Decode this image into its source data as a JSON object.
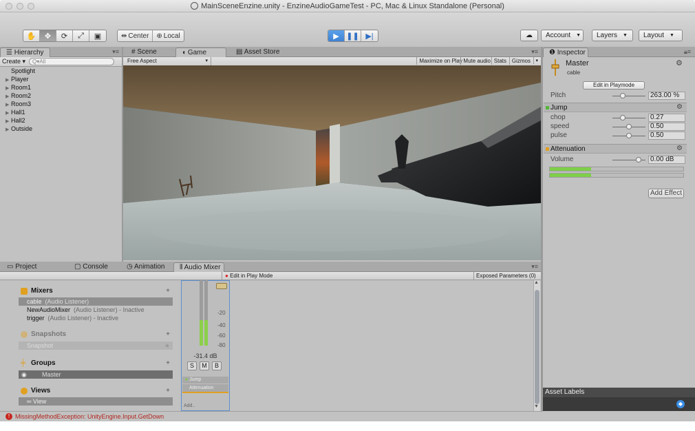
{
  "window": {
    "title": "MainSceneEnzine.unity - EnzineAudioGameTest - PC, Mac & Linux Standalone (Personal)"
  },
  "toolbar": {
    "tools": [
      "hand-icon",
      "move-icon",
      "rotate-icon",
      "scale-icon",
      "rect-icon"
    ],
    "pivot_label": "Center",
    "space_label": "Local",
    "play_icons": [
      "play-icon",
      "pause-icon",
      "step-icon"
    ],
    "account_label": "Account",
    "layers_label": "Layers",
    "layout_label": "Layout"
  },
  "hierarchy": {
    "tab_label": "Hierarchy",
    "create_label": "Create",
    "search_placeholder": "Q▾All",
    "items": [
      {
        "label": "Spotlight",
        "arrow": ""
      },
      {
        "label": "Player",
        "arrow": "▶"
      },
      {
        "label": "Room1",
        "arrow": "▶"
      },
      {
        "label": "Room2",
        "arrow": "▶"
      },
      {
        "label": "Room3",
        "arrow": "▶"
      },
      {
        "label": "Hall1",
        "arrow": "▶"
      },
      {
        "label": "Hall2",
        "arrow": "▶"
      },
      {
        "label": "Outside",
        "arrow": "▶"
      }
    ]
  },
  "center_tabs": {
    "scene": "Scene",
    "game": "Game",
    "asset_store": "Asset Store"
  },
  "game_bar": {
    "aspect": "Free Aspect",
    "maximize": "Maximize on Play",
    "mute": "Mute audio",
    "stats": "Stats",
    "gizmos": "Gizmos"
  },
  "inspector": {
    "tab_label": "Inspector",
    "object_name": "Master",
    "object_sub": "cable",
    "edit_button": "Edit in Playmode",
    "pitch_label": "Pitch",
    "pitch_value": "263.00 %",
    "pitch_level": 0.28,
    "jump": {
      "title": "Jump",
      "params": [
        {
          "label": "chop",
          "value": "0.27",
          "level": 0.27
        },
        {
          "label": "speed",
          "value": "0.50",
          "level": 0.5
        },
        {
          "label": "pulse",
          "value": "0.50",
          "level": 0.5
        }
      ]
    },
    "attenuation": {
      "title": "Attenuation",
      "volume_label": "Volume",
      "volume_value": "0.00 dB",
      "volume_level": 0.85
    },
    "add_effect": "Add Effect",
    "asset_labels": "Asset Labels"
  },
  "bottom_tabs": {
    "project": "Project",
    "console": "Console",
    "animation": "Animation",
    "audio_mixer": "Audio Mixer"
  },
  "audio_mixer": {
    "edit_in_play_mode": "Edit in Play Mode",
    "exposed_params": "Exposed Parameters (0)",
    "mixers_title": "Mixers",
    "mixers": [
      {
        "name": "cable",
        "sub": "(Audio Listener)",
        "selected": true
      },
      {
        "name": "NewAudioMixer",
        "sub": "(Audio Listener) - Inactive",
        "selected": false
      },
      {
        "name": "trigger",
        "sub": "(Audio Listener) - Inactive",
        "selected": false
      }
    ],
    "snapshots_title": "Snapshots",
    "snapshot_item": "Snapshot",
    "groups_title": "Groups",
    "group_item": "Master",
    "views_title": "Views",
    "view_item": "View",
    "strip": {
      "db_value": "-31.4 dB",
      "ticks": [
        "-20",
        "-40",
        "-60",
        "-80"
      ],
      "s_label": "S",
      "m_label": "M",
      "b_label": "B",
      "effects": [
        "Jump",
        "Attenuation"
      ],
      "add_label": "Add.."
    }
  },
  "console_error": "MissingMethodException: UnityEngine.Input.GetDown"
}
